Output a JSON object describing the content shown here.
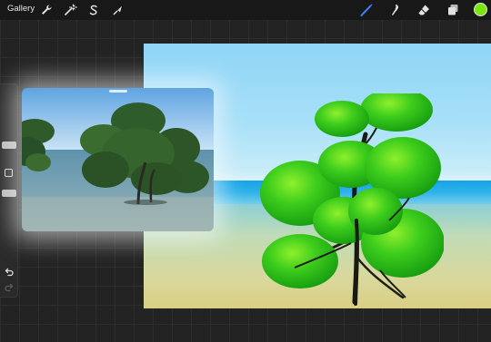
{
  "toolbar": {
    "gallery_label": "Gallery",
    "left_tools": [
      "wrench-icon",
      "magic-wand-icon",
      "selection-icon",
      "transform-arrow-icon"
    ],
    "right_tools": [
      "brush-icon",
      "smudge-icon",
      "eraser-icon",
      "layers-icon"
    ],
    "active_tool": "brush-icon",
    "active_tool_color": "#3d7df5",
    "current_color": "#7ae50f"
  },
  "sidebar": {
    "controls": [
      "brush-size-slider",
      "modify-button",
      "opacity-slider",
      "undo-icon",
      "redo-icon"
    ]
  },
  "canvas": {
    "sky_color": "#9ed9f5",
    "sea_color": "#1ea6e6",
    "sand_color": "#d9d28e",
    "tree_foliage_color": "#3ccc1c"
  },
  "reference_window": {
    "content": "photo-reference"
  }
}
